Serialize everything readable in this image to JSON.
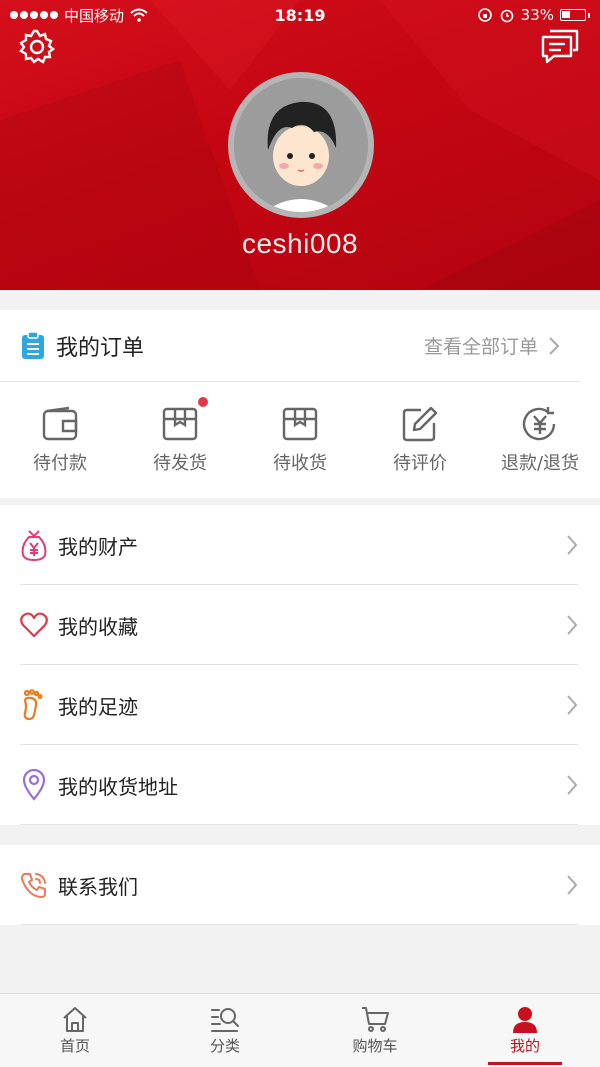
{
  "status_bar": {
    "carrier": "中国移动",
    "time": "18:19",
    "battery": "33%"
  },
  "profile": {
    "username": "ceshi008"
  },
  "orders": {
    "title": "我的订单",
    "view_all": "查看全部订单",
    "items": [
      {
        "label": "待付款",
        "icon": "wallet-icon",
        "badge": false
      },
      {
        "label": "待发货",
        "icon": "package-icon",
        "badge": true
      },
      {
        "label": "待收货",
        "icon": "box-icon",
        "badge": false
      },
      {
        "label": "待评价",
        "icon": "edit-icon",
        "badge": false
      },
      {
        "label": "退款/退货",
        "icon": "refund-icon",
        "badge": false
      }
    ]
  },
  "menu": [
    {
      "label": "我的财产",
      "icon": "money-bag-icon"
    },
    {
      "label": "我的收藏",
      "icon": "heart-icon"
    },
    {
      "label": "我的足迹",
      "icon": "footprint-icon"
    },
    {
      "label": "我的收货地址",
      "icon": "location-pin-icon"
    }
  ],
  "contact": {
    "label": "联系我们",
    "icon": "phone-icon"
  },
  "tabs": [
    {
      "label": "首页",
      "icon": "home-icon",
      "active": false
    },
    {
      "label": "分类",
      "icon": "category-search-icon",
      "active": false
    },
    {
      "label": "购物车",
      "icon": "cart-icon",
      "active": false
    },
    {
      "label": "我的",
      "icon": "user-icon",
      "active": true
    }
  ],
  "colors": {
    "brand_red": "#c8101f",
    "order_icon_blue": "#2ea7e0",
    "badge_red": "#e0394a"
  }
}
